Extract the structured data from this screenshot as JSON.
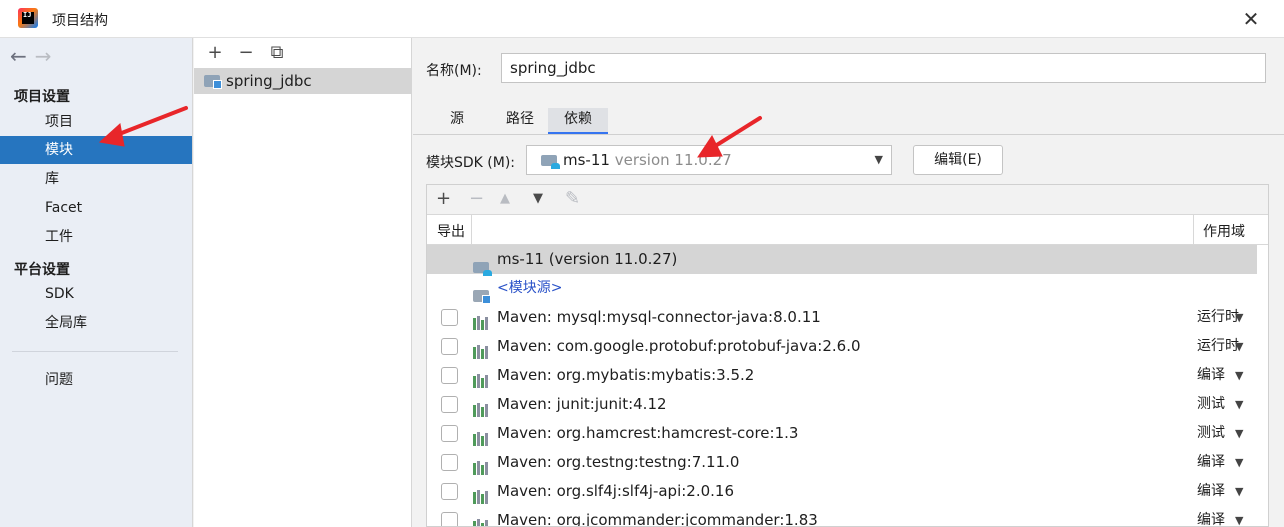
{
  "window": {
    "title": "项目结构",
    "logo_text": "IJ",
    "close_glyph": "✕"
  },
  "nav": {
    "back_glyph": "←",
    "forward_glyph": "→",
    "group_project": "项目设置",
    "group_platform": "平台设置",
    "items": [
      {
        "label": "项目"
      },
      {
        "label": "模块"
      },
      {
        "label": "库"
      },
      {
        "label": "Facet"
      },
      {
        "label": "工件"
      },
      {
        "label": "SDK"
      },
      {
        "label": "全局库"
      },
      {
        "label": "问题"
      }
    ],
    "selected": "模块"
  },
  "modules": {
    "toolbar": {
      "add": "+",
      "remove": "−",
      "copy": "⧉"
    },
    "items": [
      {
        "label": "spring_jdbc"
      }
    ]
  },
  "detail": {
    "name_label": "名称(M):",
    "name_value": "spring_jdbc",
    "tabs": [
      {
        "label": "源"
      },
      {
        "label": "路径"
      },
      {
        "label": "依赖"
      }
    ],
    "active_tab": "依赖",
    "sdk_label": "模块SDK (M):",
    "sdk_name": "ms-11",
    "sdk_version": "version 11.0.27",
    "edit_button": "编辑(E)",
    "dropdown_glyph": "▼"
  },
  "deps": {
    "toolbar": {
      "add": "+",
      "remove": "−",
      "up": "▲",
      "down": "▼",
      "edit": "✎"
    },
    "headers": {
      "export": "导出",
      "scope": "作用域"
    },
    "sdk_row": "ms-11 (version 11.0.27)",
    "module_source_row": "<模块源>",
    "rows": [
      {
        "name": "Maven: mysql:mysql-connector-java:8.0.11",
        "scope": "运行时"
      },
      {
        "name": "Maven: com.google.protobuf:protobuf-java:2.6.0",
        "scope": "运行时"
      },
      {
        "name": "Maven: org.mybatis:mybatis:3.5.2",
        "scope": "编译"
      },
      {
        "name": "Maven: junit:junit:4.12",
        "scope": "测试"
      },
      {
        "name": "Maven: org.hamcrest:hamcrest-core:1.3",
        "scope": "测试"
      },
      {
        "name": "Maven: org.testng:testng:7.11.0",
        "scope": "编译"
      },
      {
        "name": "Maven: org.slf4j:slf4j-api:2.0.16",
        "scope": "编译"
      },
      {
        "name": "Maven: org.jcommander:jcommander:1.83",
        "scope": "编译"
      }
    ]
  },
  "colors": {
    "selection_blue": "#2675bf",
    "annotation_red": "#e8262a",
    "link_blue": "#2a52c8"
  }
}
